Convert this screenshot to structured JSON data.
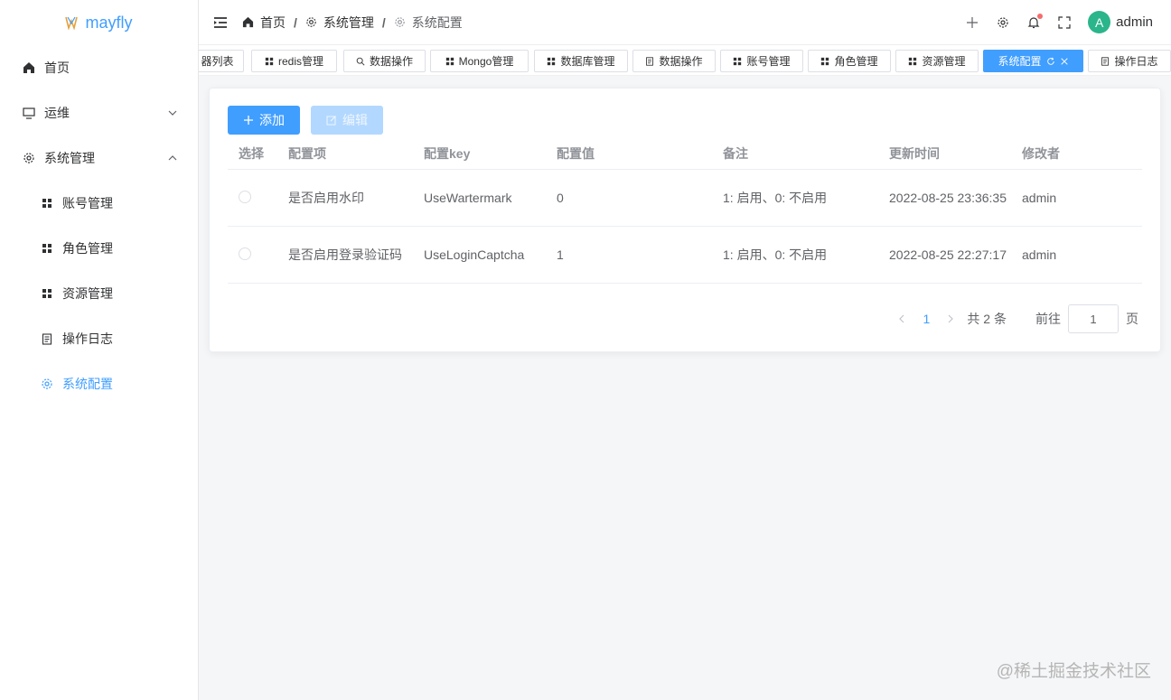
{
  "app": {
    "name": "mayfly",
    "accent": "#409eff"
  },
  "sidebar": {
    "items": [
      {
        "label": "首页",
        "icon": "home-icon"
      },
      {
        "label": "运维",
        "icon": "monitor-icon"
      },
      {
        "label": "系统管理",
        "icon": "gear-icon"
      }
    ],
    "sub_items": [
      {
        "label": "账号管理",
        "icon": "grid-icon"
      },
      {
        "label": "角色管理",
        "icon": "grid-icon"
      },
      {
        "label": "资源管理",
        "icon": "grid-icon"
      },
      {
        "label": "操作日志",
        "icon": "document-icon"
      },
      {
        "label": "系统配置",
        "icon": "gear-icon"
      }
    ]
  },
  "header": {
    "breadcrumb": [
      "首页",
      "系统管理",
      "系统配置"
    ],
    "username": "admin",
    "avatar_letter": "A"
  },
  "tags": [
    {
      "label": "器列表"
    },
    {
      "label": "redis管理"
    },
    {
      "label": "数据操作"
    },
    {
      "label": "Mongo管理"
    },
    {
      "label": "数据库管理"
    },
    {
      "label": "数据操作"
    },
    {
      "label": "账号管理"
    },
    {
      "label": "角色管理"
    },
    {
      "label": "资源管理"
    },
    {
      "label": "系统配置"
    },
    {
      "label": "操作日志"
    }
  ],
  "toolbar": {
    "add_label": "添加",
    "edit_label": "编辑"
  },
  "table": {
    "columns": [
      "选择",
      "配置项",
      "配置key",
      "配置值",
      "备注",
      "更新时间",
      "修改者"
    ],
    "rows": [
      {
        "name": "是否启用水印",
        "key": "UseWartermark",
        "value": "0",
        "remark": "1: 启用、0: 不启用",
        "updated": "2022-08-25 23:36:35",
        "modifier": "admin"
      },
      {
        "name": "是否启用登录验证码",
        "key": "UseLoginCaptcha",
        "value": "1",
        "remark": "1: 启用、0: 不启用",
        "updated": "2022-08-25 22:27:17",
        "modifier": "admin"
      }
    ]
  },
  "pagination": {
    "current": "1",
    "total_text": "共 2 条",
    "goto_label": "前往",
    "goto_value": "1",
    "page_suffix": "页"
  },
  "watermark": "@稀土掘金技术社区"
}
